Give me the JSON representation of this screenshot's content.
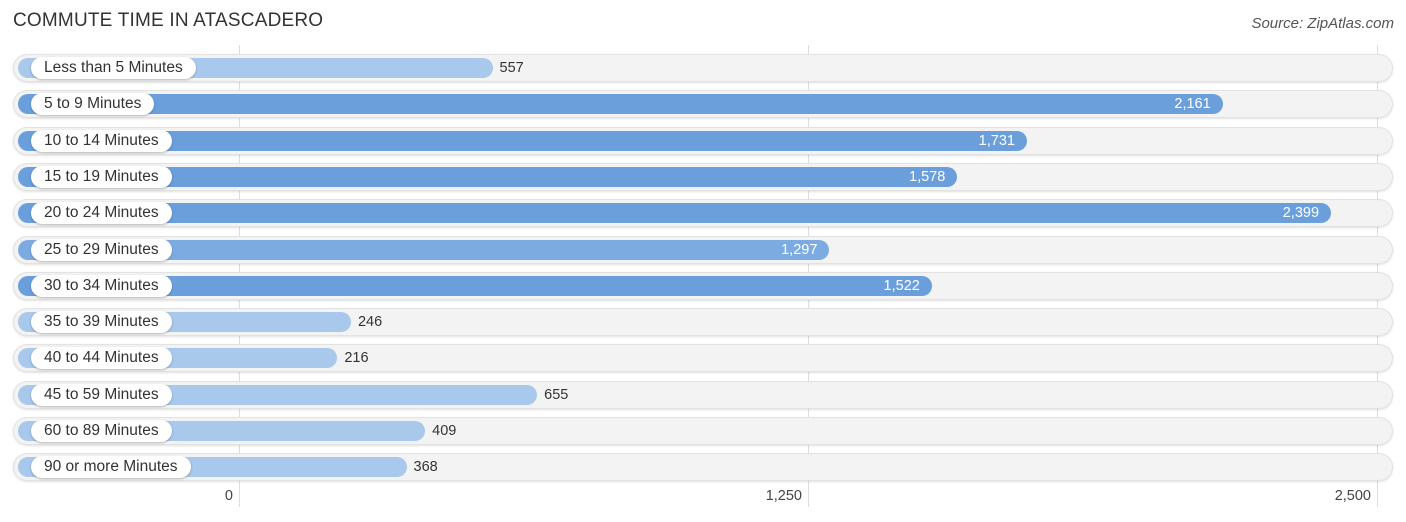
{
  "header": {
    "title": "COMMUTE TIME IN ATASCADERO",
    "source": "Source: ZipAtlas.com"
  },
  "chart_data": {
    "type": "bar",
    "orientation": "horizontal",
    "title": "COMMUTE TIME IN ATASCADERO",
    "source": "Source: ZipAtlas.com",
    "xlabel": "",
    "ylabel": "",
    "xlim": [
      0,
      2500
    ],
    "grid": true,
    "ticks": [
      {
        "value": 0,
        "label": "0"
      },
      {
        "value": 1250,
        "label": "1,250"
      },
      {
        "value": 2500,
        "label": "2,500"
      }
    ],
    "categories": [
      "Less than 5 Minutes",
      "5 to 9 Minutes",
      "10 to 14 Minutes",
      "15 to 19 Minutes",
      "20 to 24 Minutes",
      "25 to 29 Minutes",
      "30 to 34 Minutes",
      "35 to 39 Minutes",
      "40 to 44 Minutes",
      "45 to 59 Minutes",
      "60 to 89 Minutes",
      "90 or more Minutes"
    ],
    "values": [
      557,
      2161,
      1731,
      1578,
      2399,
      1297,
      1522,
      246,
      216,
      655,
      409,
      368
    ],
    "value_labels": [
      "557",
      "2,161",
      "1,731",
      "1,578",
      "2,399",
      "1,297",
      "1,522",
      "246",
      "216",
      "655",
      "409",
      "368"
    ],
    "colors": {
      "bar_dark": "#6a9fdc",
      "bar_light": "#a8c8ec",
      "track": "#f3f3f3"
    }
  }
}
